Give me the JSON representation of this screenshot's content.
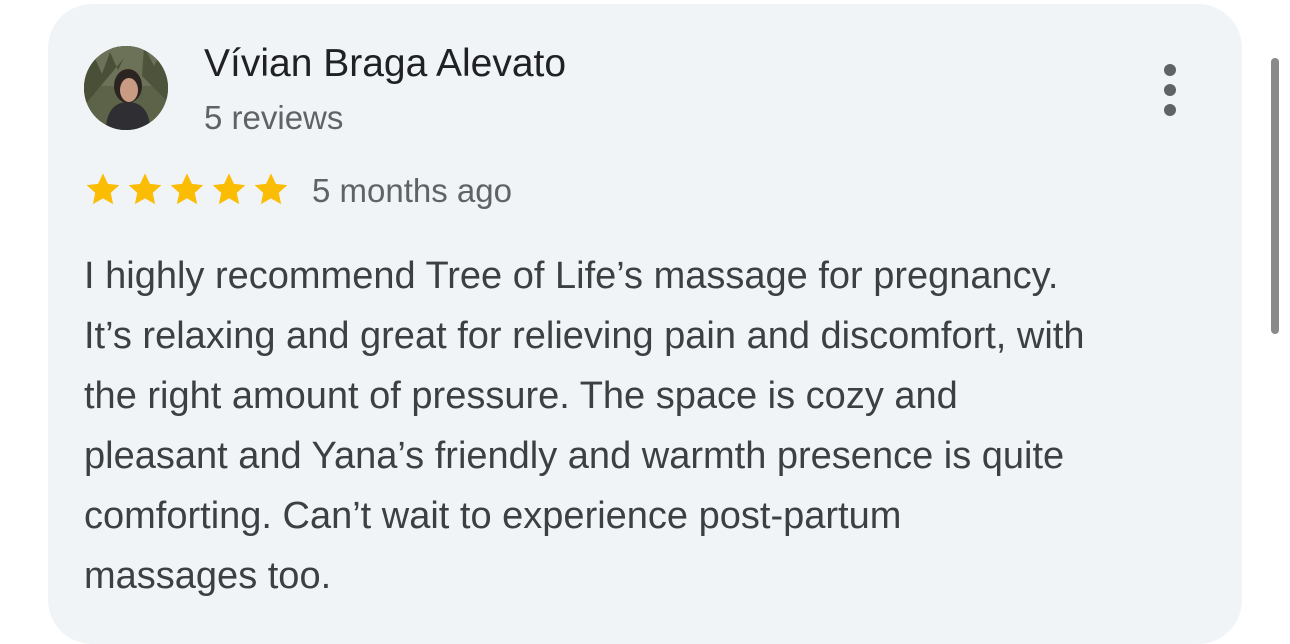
{
  "review": {
    "author_name": "Vívian Braga Alevato",
    "author_reviews": "5 reviews",
    "rating": 5,
    "rating_max": 5,
    "time_ago": "5 months ago",
    "text_lines": [
      "I highly recommend Tree of Life’s massage for pregnancy.",
      "It’s relaxing and great for relieving pain and discomfort, with",
      "the right amount of pressure. The space is cozy and",
      "pleasant and Yana’s friendly and warmth presence is quite",
      "comforting. Can’t wait to experience post-partum",
      "massages too."
    ],
    "icons": {
      "star": "star-icon",
      "menu": "more-vert-icon"
    },
    "colors": {
      "card_background": "#f1f4f6",
      "star": "#fbbc04",
      "name_text": "#202124",
      "secondary_text": "#5f6368",
      "body_text": "#3c4043"
    }
  }
}
